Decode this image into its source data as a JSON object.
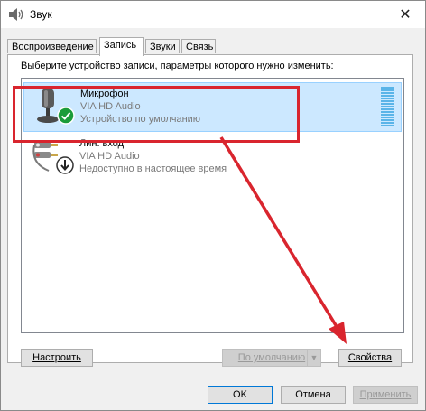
{
  "window": {
    "title": "Звук",
    "close_glyph": "✕"
  },
  "tabs": [
    {
      "label": "Воспроизведение",
      "active": false
    },
    {
      "label": "Запись",
      "active": true
    },
    {
      "label": "Звуки",
      "active": false
    },
    {
      "label": "Связь",
      "active": false
    }
  ],
  "instruction": "Выберите устройство записи, параметры которого нужно изменить:",
  "devices": [
    {
      "name": "Микрофон",
      "driver": "VIA HD Audio",
      "status": "Устройство по умолчанию",
      "selected": true,
      "icon": "microphone-icon",
      "badge": "default-checkmark-icon"
    },
    {
      "name": "Лин. вход",
      "driver": "VIA HD Audio",
      "status": "Недоступно в настоящее время",
      "selected": false,
      "icon": "line-in-icon",
      "badge": "down-arrow-icon"
    }
  ],
  "buttons": {
    "configure": "Настроить",
    "set_default": "По умолчанию",
    "properties": "Свойства",
    "ok": "OK",
    "cancel": "Отмена",
    "apply": "Применить"
  },
  "colors": {
    "annotation_red": "#d9252e",
    "selection_bg": "#cce8ff",
    "check_green": "#1c9c3a"
  }
}
